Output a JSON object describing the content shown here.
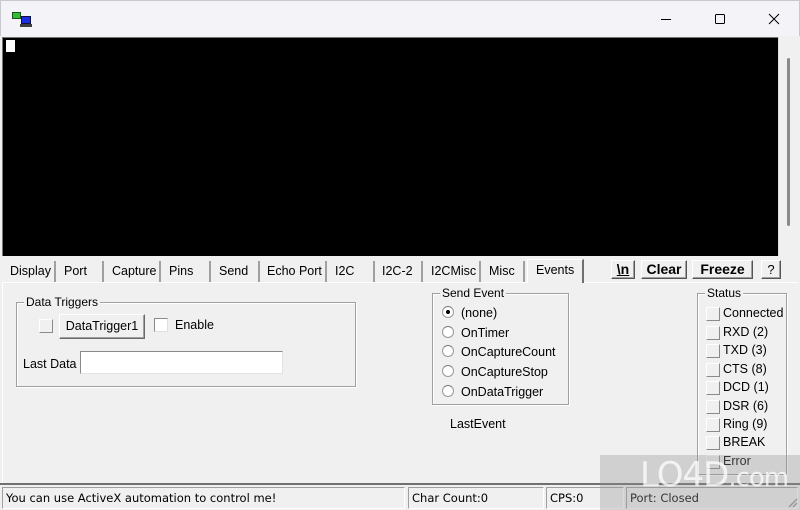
{
  "window": {
    "title": "",
    "icon": "serial-port-monitor-icon",
    "controls": {
      "minimize": "minimize-icon",
      "maximize": "maximize-icon",
      "close": "close-icon"
    }
  },
  "terminal": {
    "content": ""
  },
  "tabs": [
    {
      "label": "Display",
      "active": false
    },
    {
      "label": "Port",
      "active": false
    },
    {
      "label": "Capture",
      "active": false
    },
    {
      "label": "Pins",
      "active": false
    },
    {
      "label": "Send",
      "active": false
    },
    {
      "label": "Echo Port",
      "active": false
    },
    {
      "label": "I2C",
      "active": false
    },
    {
      "label": "I2C-2",
      "active": false
    },
    {
      "label": "I2CMisc",
      "active": false
    },
    {
      "label": "Misc",
      "active": false
    },
    {
      "label": "Events",
      "active": true
    }
  ],
  "toolbar": {
    "newline_label": "\\n",
    "clear_label": "Clear",
    "freeze_label": "Freeze",
    "help_label": "?"
  },
  "data_triggers": {
    "title": "Data Triggers",
    "trigger_button": "DataTrigger1",
    "enable_label": "Enable",
    "enable_checked": false,
    "last_data_label": "Last Data",
    "last_data_value": ""
  },
  "send_event": {
    "title": "Send Event",
    "options": [
      {
        "label": "(none)",
        "selected": true
      },
      {
        "label": "OnTimer",
        "selected": false
      },
      {
        "label": "OnCaptureCount",
        "selected": false
      },
      {
        "label": "OnCaptureStop",
        "selected": false
      },
      {
        "label": "OnDataTrigger",
        "selected": false
      }
    ],
    "last_event_label": "LastEvent"
  },
  "status": {
    "title": "Status",
    "items": [
      {
        "label": "Connected"
      },
      {
        "label": "RXD (2)"
      },
      {
        "label": "TXD (3)"
      },
      {
        "label": "CTS (8)"
      },
      {
        "label": "DCD (1)"
      },
      {
        "label": "DSR (6)"
      },
      {
        "label": "Ring (9)"
      },
      {
        "label": "BREAK"
      },
      {
        "label": "Error"
      }
    ]
  },
  "statusbar": {
    "message": "You can use ActiveX automation to control me!",
    "char_count": "Char Count:0",
    "cps": "CPS:0",
    "port_status": "Port: Closed"
  },
  "watermark": {
    "text": "LO4D",
    "suffix": ".com"
  }
}
